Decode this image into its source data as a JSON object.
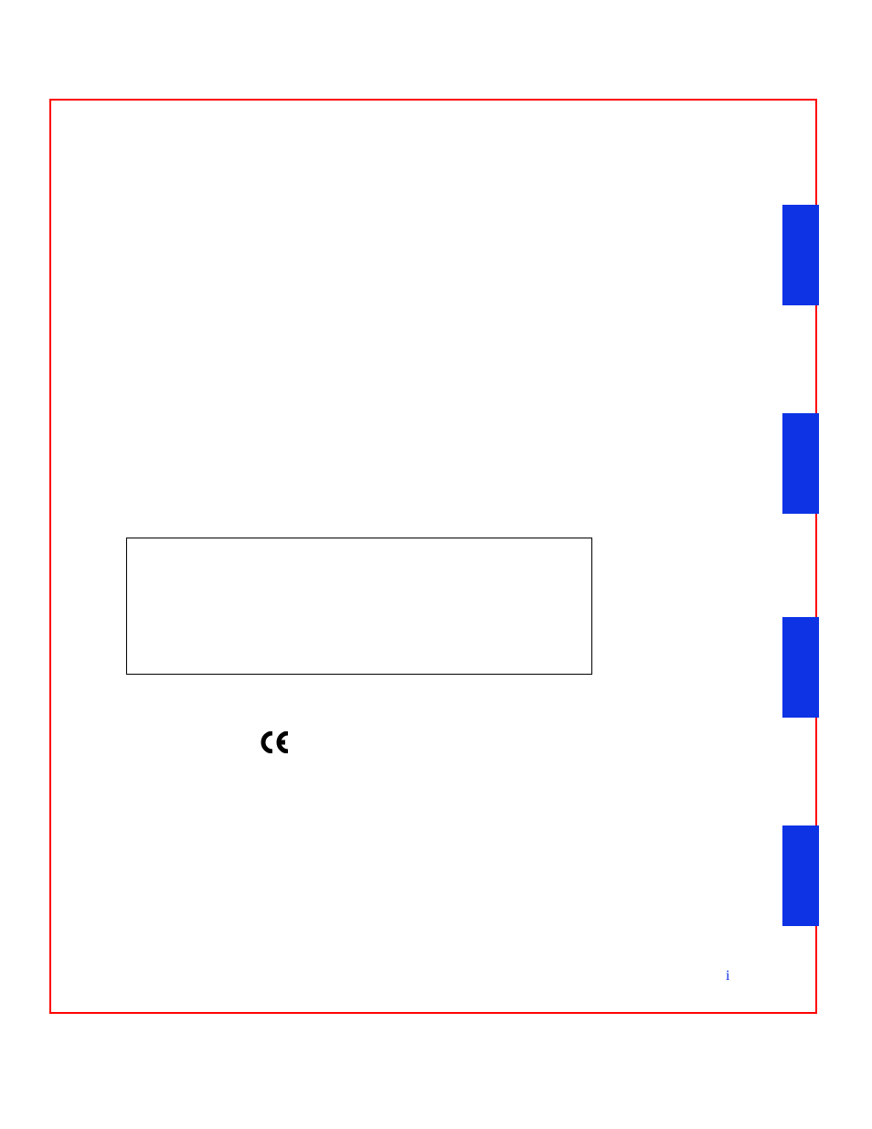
{
  "page_number": "i",
  "ce_label": "CE"
}
